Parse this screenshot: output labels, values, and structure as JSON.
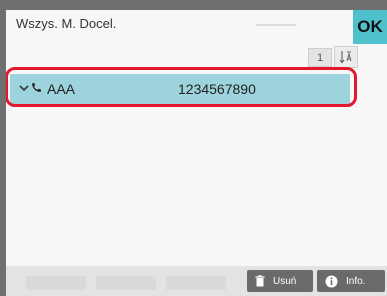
{
  "header": {
    "title": "Wszys. M. Docel.",
    "ok_label": "OK"
  },
  "pagination": {
    "page": "1"
  },
  "list": {
    "items": [
      {
        "name": "AAA",
        "number": "1234567890",
        "icon": "phone-icon",
        "selected": true
      }
    ]
  },
  "footer": {
    "delete_label": "Usuń",
    "info_label": "Info."
  },
  "colors": {
    "accent": "#4fc1cd",
    "selected_row": "#9dd3dc",
    "highlight": "#e3182d",
    "button": "#6a6a6a"
  }
}
